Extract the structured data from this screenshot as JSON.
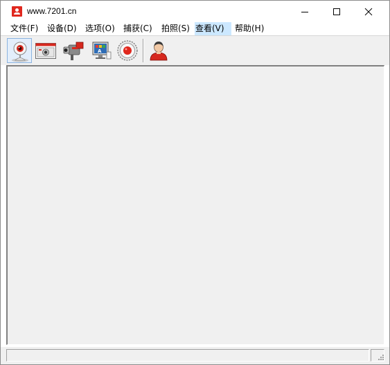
{
  "window": {
    "title": "www.7201.cn"
  },
  "menu": [
    {
      "label": "文件(F)"
    },
    {
      "label": "设备(D)"
    },
    {
      "label": "选项(O)"
    },
    {
      "label": "捕获(C)"
    },
    {
      "label": "拍照(S)"
    },
    {
      "label": "查看(V)",
      "active": true
    },
    {
      "label": "帮助(H)"
    }
  ],
  "toolbar": {
    "buttons": [
      {
        "icon": "webcam-icon",
        "pressed": true
      },
      {
        "icon": "camera-window-icon"
      },
      {
        "icon": "video-camera-icon"
      },
      {
        "icon": "monitor-palette-icon"
      },
      {
        "icon": "record-icon"
      },
      {
        "icon": "user-icon"
      }
    ]
  },
  "colors": {
    "accent": "#e0281e",
    "menu_active": "#cce8ff",
    "workspace": "#f0f0f0"
  }
}
